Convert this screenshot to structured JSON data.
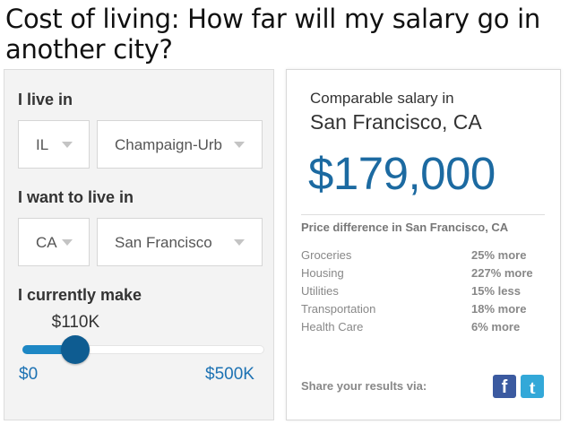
{
  "headline": "Cost of living: How far will my salary go in another city?",
  "calculator": {
    "live_label": "I live in",
    "live_state": "IL",
    "live_city": "Champaign-Urb",
    "want_label": "I want to live in",
    "want_state": "CA",
    "want_city": "San Francisco",
    "make_label": "I currently make",
    "salary_value": "$110K",
    "salary_fraction": 0.22,
    "range_min": "$0",
    "range_max": "$500K"
  },
  "results": {
    "comparable_label": "Comparable salary in",
    "city": "San Francisco, CA",
    "salary": "$179,000",
    "price_diff_title": "Price difference in San Francisco, CA",
    "rows": [
      {
        "category": "Groceries",
        "diff": "25% more"
      },
      {
        "category": "Housing",
        "diff": "227% more"
      },
      {
        "category": "Utilities",
        "diff": "15% less"
      },
      {
        "category": "Transportation",
        "diff": "18% more"
      },
      {
        "category": "Health Care",
        "diff": "6% more"
      }
    ],
    "share_label": "Share your results via:",
    "facebook_glyph": "f",
    "twitter_glyph": "t"
  },
  "colors": {
    "accent": "#1c6aa1",
    "slider_fill": "#1d87c4",
    "knob": "#0e5c91",
    "facebook": "#3b5aa0",
    "twitter": "#33a8d8"
  }
}
